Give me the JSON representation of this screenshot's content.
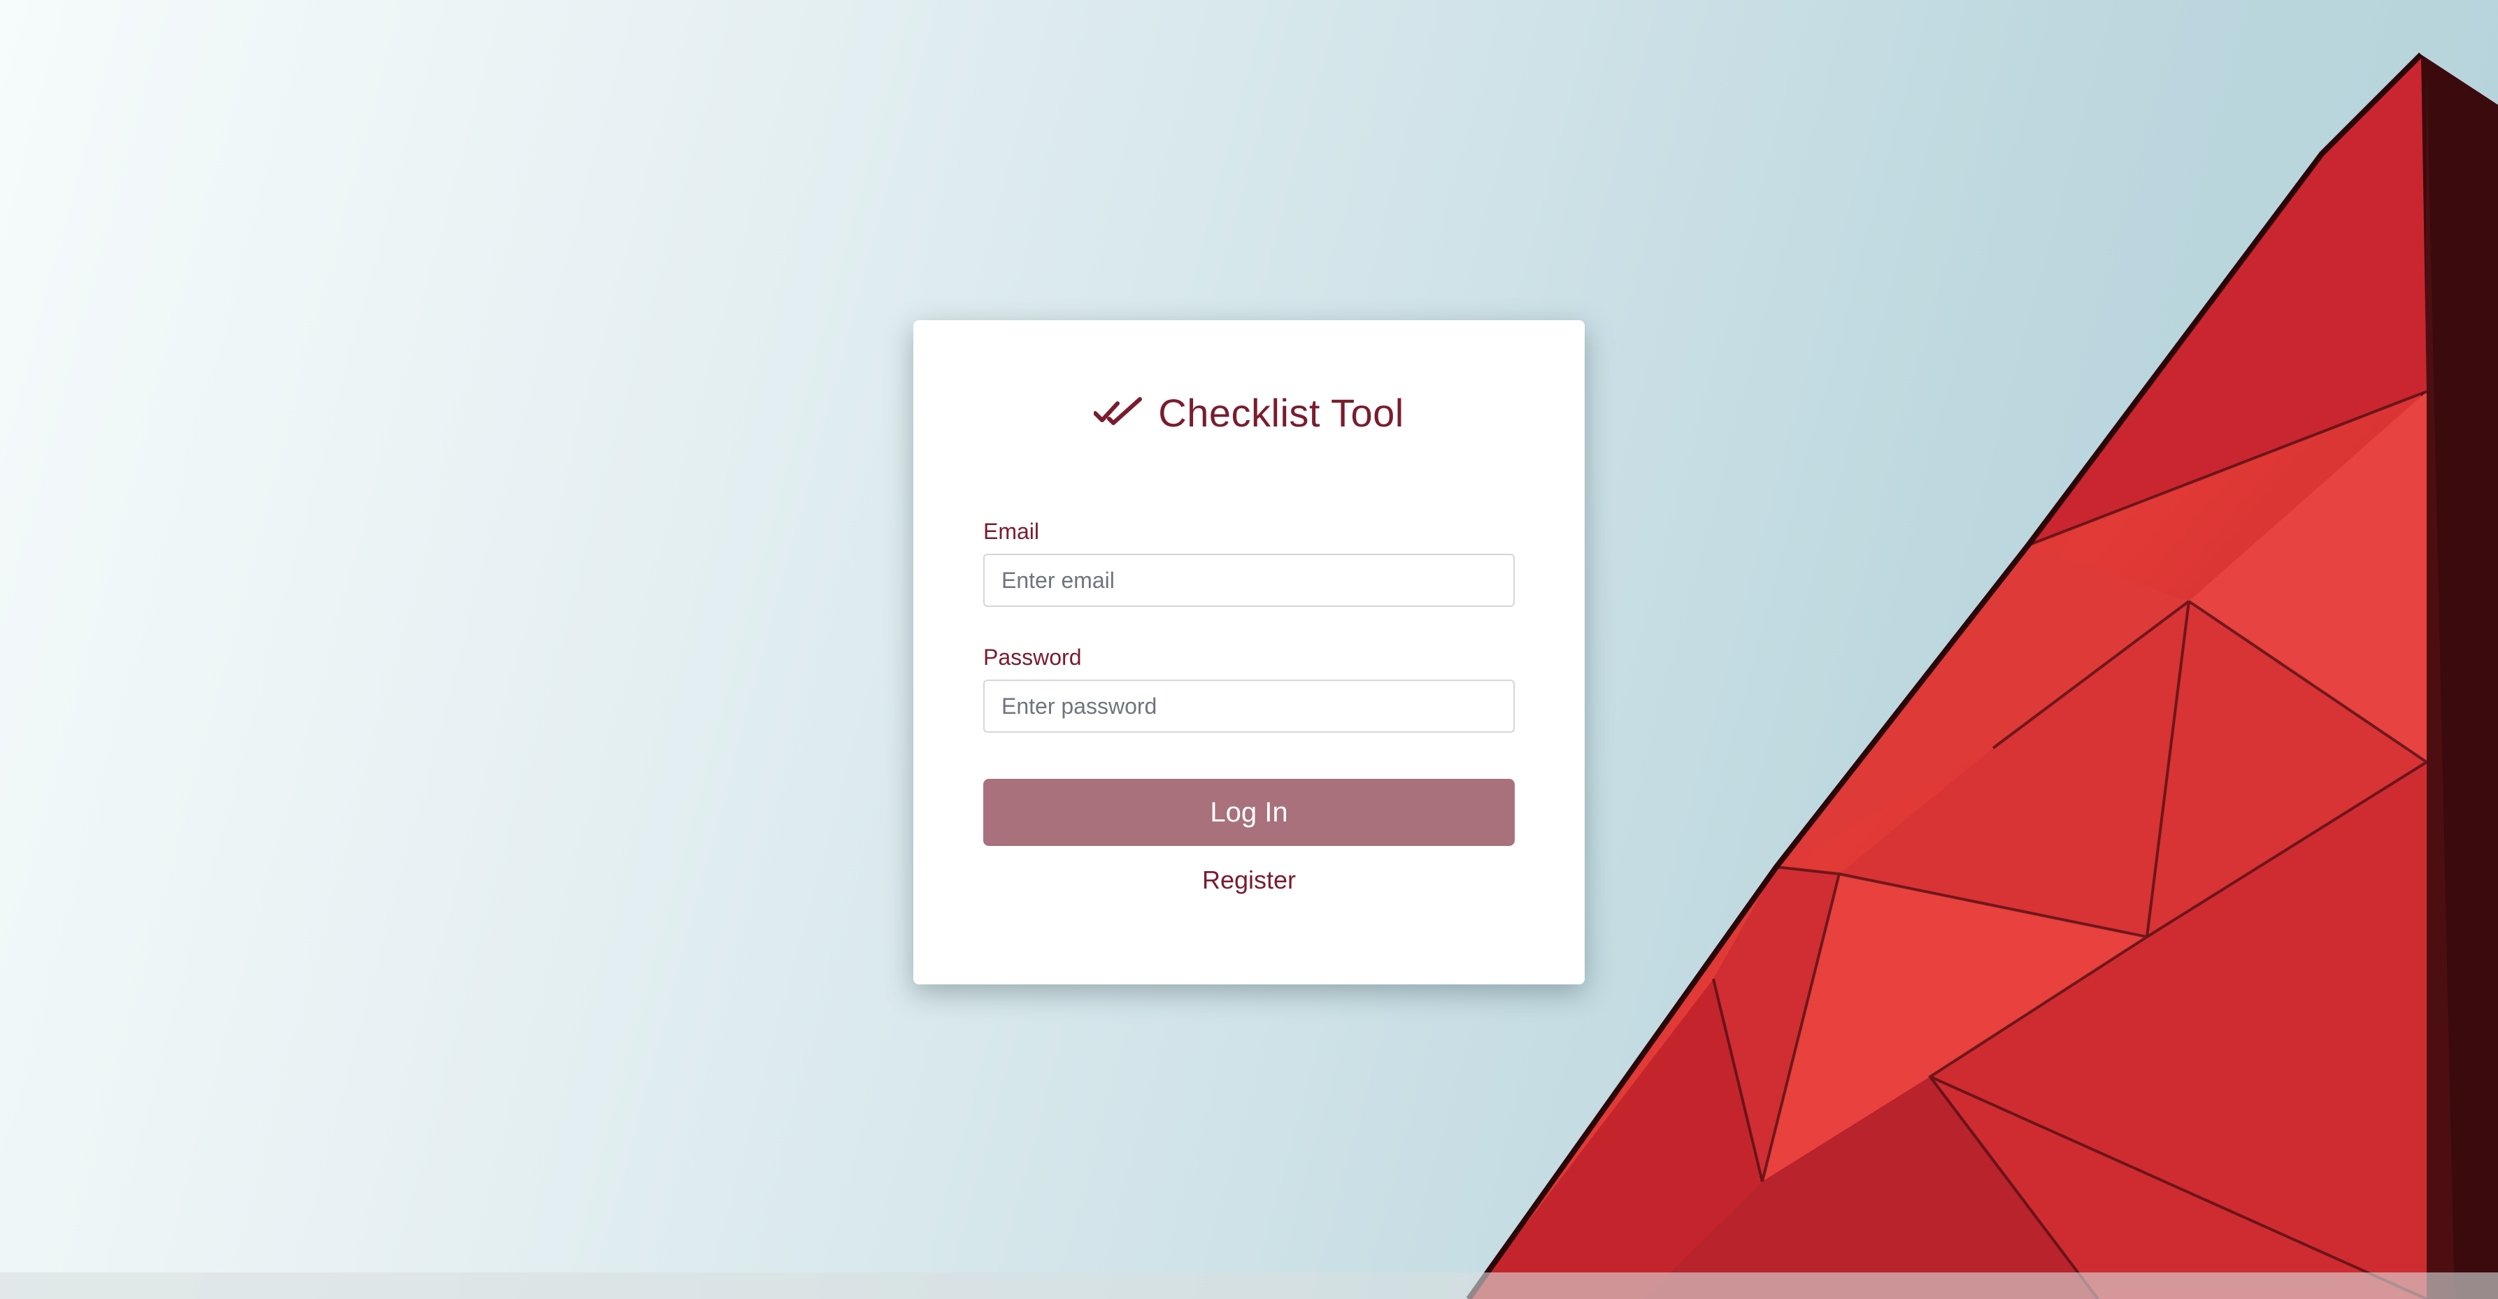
{
  "app": {
    "title": "Checklist Tool",
    "icon": "double-check-icon"
  },
  "form": {
    "email_label": "Email",
    "email_placeholder": "Enter email",
    "email_value": "",
    "password_label": "Password",
    "password_placeholder": "Enter password",
    "password_value": "",
    "login_label": "Log In",
    "register_label": "Register"
  },
  "colors": {
    "brand": "#7a1c2e",
    "button": "#a8717c",
    "building_red": "#d9312f"
  }
}
